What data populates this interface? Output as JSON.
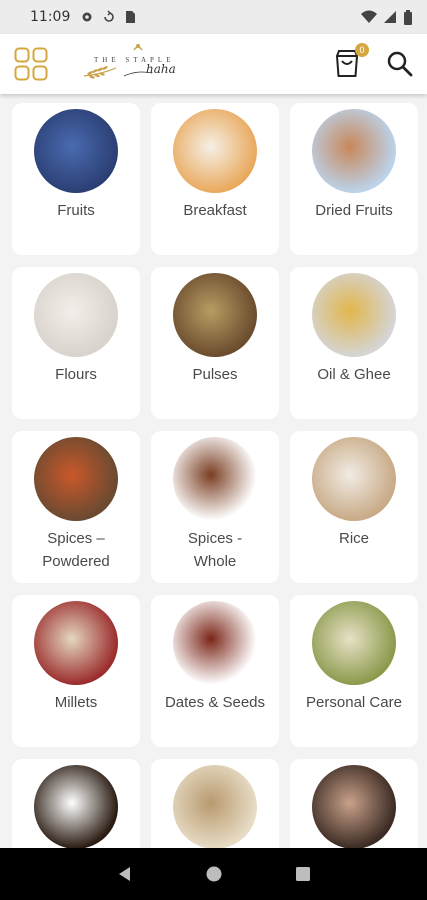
{
  "status_bar": {
    "time": "11:09"
  },
  "header": {
    "logo_top_text": "THE STAPLE",
    "logo_script_text": "haha",
    "cart_count": "0"
  },
  "categories": [
    {
      "label": "Fruits",
      "colors": [
        "#2b3f74",
        "#4a6bb0"
      ]
    },
    {
      "label": "Breakfast",
      "colors": [
        "#e9a95d",
        "#f5f0e6"
      ]
    },
    {
      "label": "Dried Fruits",
      "colors": [
        "#bcd3ea",
        "#c8875a"
      ]
    },
    {
      "label": "Flours",
      "colors": [
        "#d8d3cc",
        "#f2eee9"
      ]
    },
    {
      "label": "Pulses",
      "colors": [
        "#6b4c2e",
        "#b79d63"
      ]
    },
    {
      "label": "Oil & Ghee",
      "colors": [
        "#d5d5d5",
        "#e1b64b"
      ]
    },
    {
      "label": "Spices – Powdered",
      "colors": [
        "#6a4a31",
        "#c9582a"
      ]
    },
    {
      "label": "Spices - Whole",
      "colors": [
        "#ffffff",
        "#7a3e22"
      ]
    },
    {
      "label": "Rice",
      "colors": [
        "#c8aa86",
        "#f1ece4"
      ]
    },
    {
      "label": "Millets",
      "colors": [
        "#9b2d2d",
        "#e4d7c0"
      ]
    },
    {
      "label": "Dates & Seeds",
      "colors": [
        "#ffffff",
        "#7b2618"
      ]
    },
    {
      "label": "Personal Care",
      "colors": [
        "#8c9a4c",
        "#e8e1c7"
      ]
    },
    {
      "label": "",
      "colors": [
        "#2a1c12",
        "#ffffff"
      ]
    },
    {
      "label": "",
      "colors": [
        "#e7dcc5",
        "#b89a6f"
      ]
    },
    {
      "label": "",
      "colors": [
        "#3b2b23",
        "#c9a18b"
      ]
    }
  ]
}
